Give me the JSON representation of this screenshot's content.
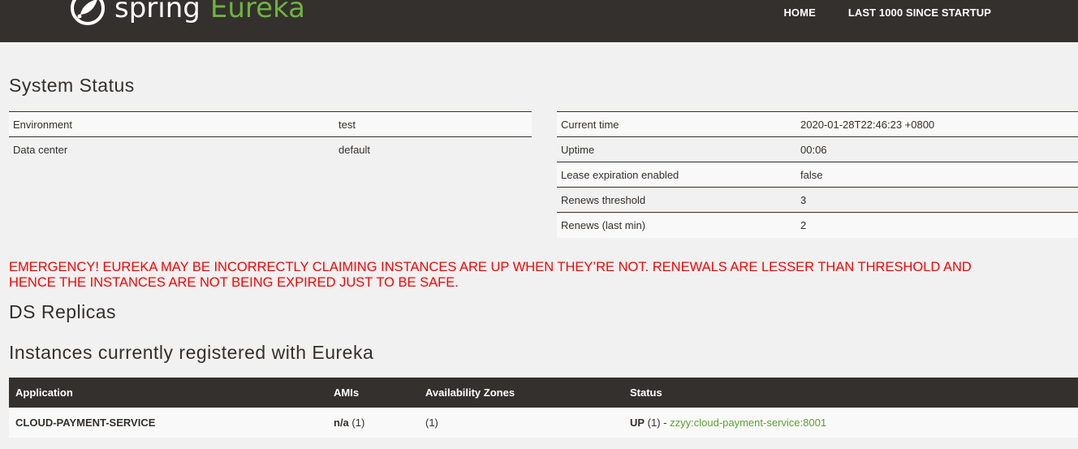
{
  "header": {
    "brand_spring": "spring",
    "brand_eureka": "Eureka",
    "nav": [
      {
        "label": "HOME"
      },
      {
        "label": "LAST 1000 SINCE STARTUP"
      }
    ]
  },
  "system_status": {
    "title": "System Status",
    "left": [
      {
        "key": "Environment",
        "value": "test"
      },
      {
        "key": "Data center",
        "value": "default"
      }
    ],
    "right": [
      {
        "key": "Current time",
        "value": "2020-01-28T22:46:23 +0800"
      },
      {
        "key": "Uptime",
        "value": "00:06"
      },
      {
        "key": "Lease expiration enabled",
        "value": "false"
      },
      {
        "key": "Renews threshold",
        "value": "3"
      },
      {
        "key": "Renews (last min)",
        "value": "2"
      }
    ]
  },
  "emergency": {
    "line1": "EMERGENCY! EUREKA MAY BE INCORRECTLY CLAIMING INSTANCES ARE UP WHEN THEY’RE NOT. RENEWALS ARE LESSER THAN THRESHOLD AND",
    "line2": "HENCE THE INSTANCES ARE NOT BEING EXPIRED JUST TO BE SAFE."
  },
  "replicas": {
    "title": "DS Replicas"
  },
  "instances": {
    "title": "Instances currently registered with Eureka",
    "headers": {
      "application": "Application",
      "amis": "AMIs",
      "zones": "Availability Zones",
      "status": "Status"
    },
    "rows": [
      {
        "application": "CLOUD-PAYMENT-SERVICE",
        "amis_bold": "n/a",
        "amis_count": " (1)",
        "zones": "(1)",
        "status_bold": "UP",
        "status_count": " (1) - ",
        "status_link": "zzyy:cloud-payment-service:8001"
      }
    ]
  },
  "colors": {
    "header_bg": "#34302d",
    "accent_green": "#6db33f",
    "emergency_red": "#ff0000",
    "page_bg": "#f1f1f1"
  }
}
